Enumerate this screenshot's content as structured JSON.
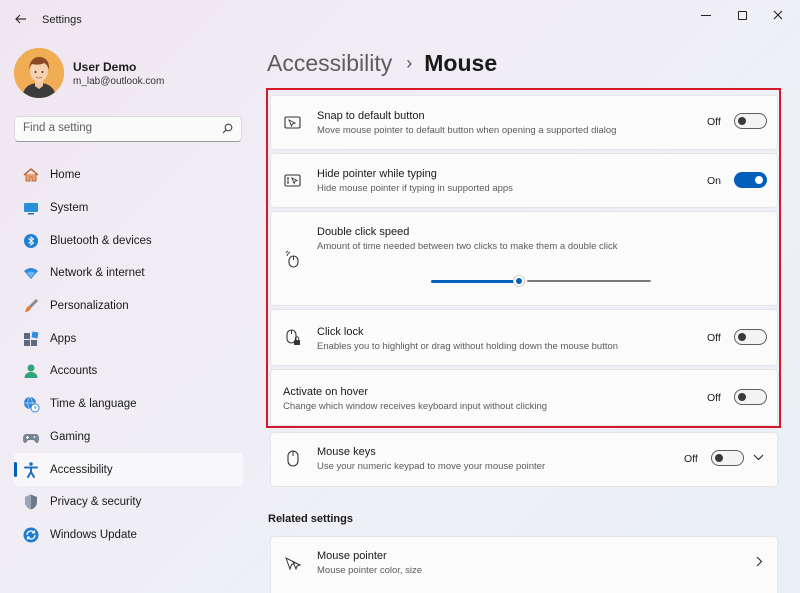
{
  "window": {
    "title": "Settings",
    "back_icon": "back-arrow-icon",
    "controls": [
      "minimize",
      "maximize",
      "close"
    ]
  },
  "user": {
    "name": "User Demo",
    "email": "m_lab@outlook.com"
  },
  "search": {
    "placeholder": "Find a setting",
    "value": ""
  },
  "nav": {
    "items": [
      {
        "label": "Home",
        "icon": "home-icon",
        "active": false
      },
      {
        "label": "System",
        "icon": "system-icon",
        "active": false
      },
      {
        "label": "Bluetooth & devices",
        "icon": "bluetooth-icon",
        "active": false
      },
      {
        "label": "Network & internet",
        "icon": "network-icon",
        "active": false
      },
      {
        "label": "Personalization",
        "icon": "brush-icon",
        "active": false
      },
      {
        "label": "Apps",
        "icon": "apps-icon",
        "active": false
      },
      {
        "label": "Accounts",
        "icon": "accounts-icon",
        "active": false
      },
      {
        "label": "Time & language",
        "icon": "globe-clock-icon",
        "active": false
      },
      {
        "label": "Gaming",
        "icon": "gamepad-icon",
        "active": false
      },
      {
        "label": "Accessibility",
        "icon": "accessibility-icon",
        "active": true
      },
      {
        "label": "Privacy & security",
        "icon": "shield-icon",
        "active": false
      },
      {
        "label": "Windows Update",
        "icon": "update-icon",
        "active": false
      }
    ]
  },
  "header": {
    "parent": "Accessibility",
    "separator": "›",
    "current": "Mouse"
  },
  "settings": {
    "snap": {
      "title": "Snap to default button",
      "desc": "Move mouse pointer to default button when opening a supported dialog",
      "state": "Off"
    },
    "hide_pointer": {
      "title": "Hide pointer while typing",
      "desc": "Hide mouse pointer if typing in supported apps",
      "state": "On"
    },
    "double_click": {
      "title": "Double click speed",
      "desc": "Amount of time needed between two clicks to make them a double click",
      "slider_fraction": 0.4
    },
    "click_lock": {
      "title": "Click lock",
      "desc": "Enables you to highlight or drag without holding down the mouse button",
      "state": "Off"
    },
    "activate_hover": {
      "title": "Activate on hover",
      "desc": "Change which window receives keyboard input without clicking",
      "state": "Off"
    },
    "mouse_keys": {
      "title": "Mouse keys",
      "desc": "Use your numeric keypad to move your mouse pointer",
      "state": "Off"
    }
  },
  "related": {
    "heading": "Related settings",
    "mouse_pointer": {
      "title": "Mouse pointer",
      "desc": "Mouse pointer color, size"
    }
  },
  "colors": {
    "accent": "#005fb8",
    "highlight_border": "#d3192a"
  }
}
